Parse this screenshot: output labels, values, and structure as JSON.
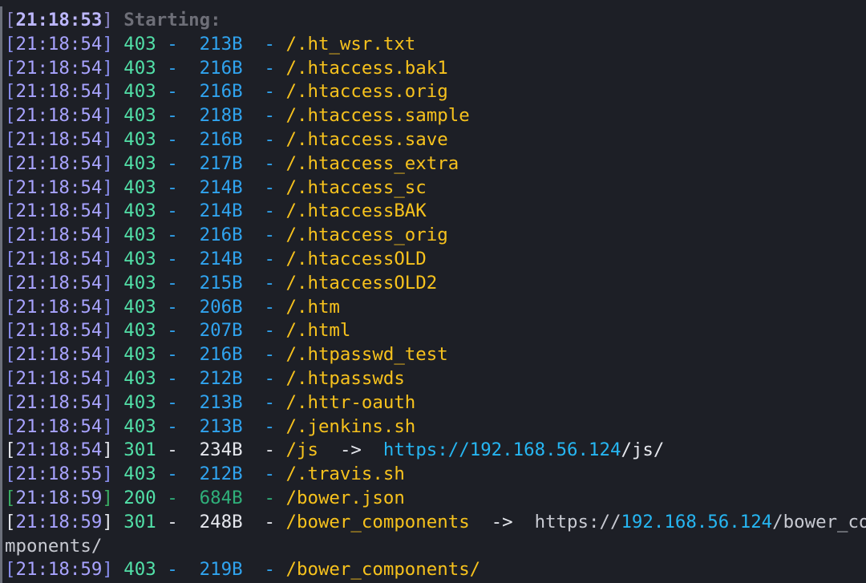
{
  "terminal": {
    "header": {
      "open": "[",
      "time": "21:18:53",
      "close": "]",
      "label": " Starting:"
    },
    "entries": [
      {
        "time": "21:18:54",
        "status": "403",
        "size": "213B",
        "path": "/.ht_wsr.txt"
      },
      {
        "time": "21:18:54",
        "status": "403",
        "size": "216B",
        "path": "/.htaccess.bak1"
      },
      {
        "time": "21:18:54",
        "status": "403",
        "size": "216B",
        "path": "/.htaccess.orig"
      },
      {
        "time": "21:18:54",
        "status": "403",
        "size": "218B",
        "path": "/.htaccess.sample"
      },
      {
        "time": "21:18:54",
        "status": "403",
        "size": "216B",
        "path": "/.htaccess.save"
      },
      {
        "time": "21:18:54",
        "status": "403",
        "size": "217B",
        "path": "/.htaccess_extra"
      },
      {
        "time": "21:18:54",
        "status": "403",
        "size": "214B",
        "path": "/.htaccess_sc"
      },
      {
        "time": "21:18:54",
        "status": "403",
        "size": "214B",
        "path": "/.htaccessBAK"
      },
      {
        "time": "21:18:54",
        "status": "403",
        "size": "216B",
        "path": "/.htaccess_orig"
      },
      {
        "time": "21:18:54",
        "status": "403",
        "size": "214B",
        "path": "/.htaccessOLD"
      },
      {
        "time": "21:18:54",
        "status": "403",
        "size": "215B",
        "path": "/.htaccessOLD2"
      },
      {
        "time": "21:18:54",
        "status": "403",
        "size": "206B",
        "path": "/.htm"
      },
      {
        "time": "21:18:54",
        "status": "403",
        "size": "207B",
        "path": "/.html"
      },
      {
        "time": "21:18:54",
        "status": "403",
        "size": "216B",
        "path": "/.htpasswd_test"
      },
      {
        "time": "21:18:54",
        "status": "403",
        "size": "212B",
        "path": "/.htpasswds"
      },
      {
        "time": "21:18:54",
        "status": "403",
        "size": "213B",
        "path": "/.httr-oauth"
      },
      {
        "time": "21:18:54",
        "status": "403",
        "size": "213B",
        "path": "/.jenkins.sh"
      }
    ],
    "redirect_js": {
      "time": "21:18:54",
      "status": "301",
      "size": "234B",
      "path": "/js",
      "arrow": "->",
      "url_proto": "https://",
      "url_host": "192.168.56.124",
      "url_path": "/js/"
    },
    "travis": {
      "time": "21:18:55",
      "status": "403",
      "size": "212B",
      "path": "/.travis.sh"
    },
    "bower_json": {
      "time": "21:18:59",
      "status": "200",
      "size": "684B",
      "path": "/bower.json"
    },
    "redirect_bower": {
      "time": "21:18:59",
      "status": "301",
      "size": "248B",
      "path": "/bower_components",
      "arrow": "->",
      "url_proto": "https://",
      "url_host": "192.168.56.124",
      "url_path_a": "/bower_co",
      "url_path_b": "mponents/"
    },
    "bower_dir": {
      "time": "21:18:59",
      "status": "403",
      "size": "219B",
      "path": "/bower_components/"
    },
    "colors": {
      "background": "#1d1f26",
      "status_green": "#52e0a8",
      "size_blue": "#30a4f0",
      "path_gold": "#f7c21d",
      "timestamp_purple": "#a8a3ff",
      "url_cyan": "#26b6f2"
    }
  }
}
